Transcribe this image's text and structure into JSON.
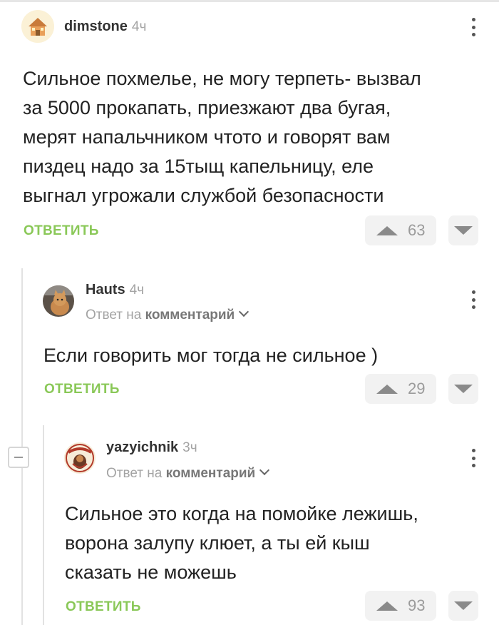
{
  "comments": [
    {
      "author": "dimstone",
      "age": "4ч",
      "text_lines": [
        "Сильное похмелье, не могу терпеть- вызвал",
        "за 5000 прокапать, приезжают два бугая,",
        "мерят напальчником чтото и говорят вам",
        "пиздец надо за 15тыщ капельницу, еле",
        "выгнал угрожали службой безопасности"
      ],
      "reply_label": "ОТВЕТИТЬ",
      "score": "63"
    },
    {
      "author": "Hauts",
      "age": "4ч",
      "reply_to_prefix": "Ответ на",
      "reply_to_link": "комментарий",
      "text_lines": [
        "Если говорить мог тогда не сильное )"
      ],
      "reply_label": "ОТВЕТИТЬ",
      "score": "29"
    },
    {
      "author": "yazyichnik",
      "age": "3ч",
      "reply_to_prefix": "Ответ на",
      "reply_to_link": "комментарий",
      "text_lines": [
        "Сильное это когда на помойке лежишь,",
        "ворона залупу клюет, а ты ей кыш",
        "сказать не можешь"
      ],
      "reply_label": "ОТВЕТИТЬ",
      "score": "93"
    }
  ],
  "icons": {
    "menu": "more-vertical-icon",
    "upvote": "arrow-up-triangle-icon",
    "downvote": "arrow-down-triangle-icon",
    "collapse": "minus-square-icon",
    "reply_to_toggle": "chevron-down-icon"
  },
  "colors": {
    "accent_green": "#8ac858",
    "muted_text": "#a3a3a3",
    "vote_bg": "#f2f2f2"
  }
}
